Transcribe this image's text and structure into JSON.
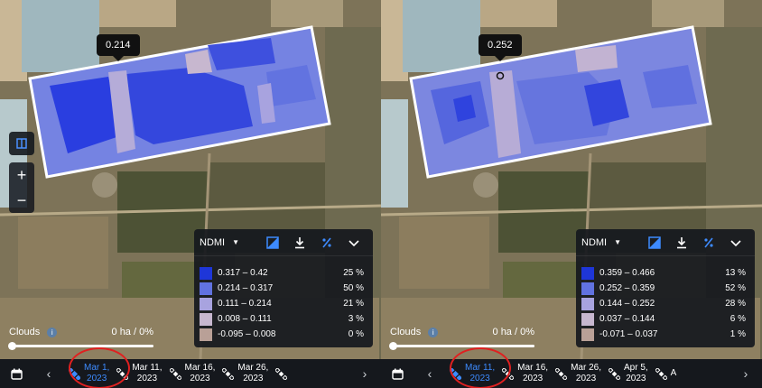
{
  "colors": {
    "scale": [
      "#1e36d8",
      "#6172e0",
      "#a8a3df",
      "#c7b7cf",
      "#b9a097"
    ],
    "accent": "#3d8bff",
    "ring": "#e02020"
  },
  "left": {
    "tooltip": "0.214",
    "controls": {
      "split_icon": "split-view-icon",
      "zoom_in": "+",
      "zoom_out": "−"
    },
    "legend": {
      "index": "NDMI",
      "rows": [
        {
          "range": "0.317 – 0.42",
          "pct": "25 %"
        },
        {
          "range": "0.214 – 0.317",
          "pct": "50 %"
        },
        {
          "range": "0.111 – 0.214",
          "pct": "21 %"
        },
        {
          "range": "0.008 – 0.111",
          "pct": "3 %"
        },
        {
          "range": "-0.095 – 0.008",
          "pct": "0 %"
        }
      ]
    },
    "clouds": {
      "label": "Clouds",
      "value": "0 ha / 0%"
    },
    "timeline": [
      {
        "line1": "Mar 1,",
        "line2": "2023",
        "active": true
      },
      {
        "line1": "Mar 11,",
        "line2": "2023"
      },
      {
        "line1": "Mar 16,",
        "line2": "2023"
      },
      {
        "line1": "Mar 26,",
        "line2": "2023"
      },
      {
        "line1": "",
        "line2": ""
      }
    ]
  },
  "right": {
    "tooltip": "0.252",
    "legend": {
      "index": "NDMI",
      "rows": [
        {
          "range": "0.359 – 0.466",
          "pct": "13 %"
        },
        {
          "range": "0.252 – 0.359",
          "pct": "52 %"
        },
        {
          "range": "0.144 – 0.252",
          "pct": "28 %"
        },
        {
          "range": "0.037 – 0.144",
          "pct": "6 %"
        },
        {
          "range": "-0.071 – 0.037",
          "pct": "1 %"
        }
      ]
    },
    "clouds": {
      "label": "Clouds",
      "value": "0 ha / 0%"
    },
    "timeline": [
      {
        "line1": "Mar 11,",
        "line2": "2023",
        "active": true
      },
      {
        "line1": "Mar 16,",
        "line2": "2023"
      },
      {
        "line1": "Mar 26,",
        "line2": "2023"
      },
      {
        "line1": "Apr 5,",
        "line2": "2023"
      },
      {
        "line1": "A",
        "line2": ""
      }
    ]
  }
}
